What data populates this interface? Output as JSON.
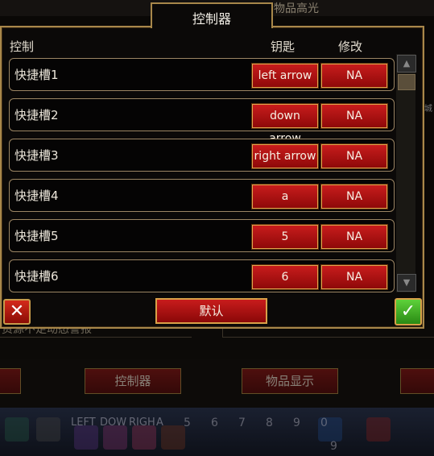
{
  "background": {
    "top_label": "物品高光",
    "notice_text": "资源不足动态警报",
    "tab_buttons": [
      "控制器",
      "物品显示"
    ],
    "hotbar": {
      "key_labels": [
        "LEFT",
        "DOW",
        "RIGH",
        "A"
      ],
      "slot_numbers": [
        "5",
        "6",
        "7",
        "8",
        "9",
        "0"
      ],
      "extra_number": "9"
    },
    "side_text": "城"
  },
  "dialog": {
    "title": "控制器",
    "headers": {
      "control": "控制",
      "key": "钥匙",
      "modify": "修改"
    },
    "rows": [
      {
        "label": "快捷槽1",
        "key": "left arrow",
        "modify": "NA"
      },
      {
        "label": "快捷槽2",
        "key": "down arrow",
        "modify": "NA"
      },
      {
        "label": "快捷槽3",
        "key": "right arrow",
        "modify": "NA"
      },
      {
        "label": "快捷槽4",
        "key": "a",
        "modify": "NA"
      },
      {
        "label": "快捷槽5",
        "key": "5",
        "modify": "NA"
      },
      {
        "label": "快捷槽6",
        "key": "6",
        "modify": "NA"
      }
    ],
    "default_button": "默认",
    "close_icon": "close-x-icon",
    "confirm_icon": "checkmark-icon"
  },
  "colors": {
    "button_red": "#c81c1c",
    "border_gold": "#a8874a",
    "confirm_green": "#5ed13a"
  }
}
